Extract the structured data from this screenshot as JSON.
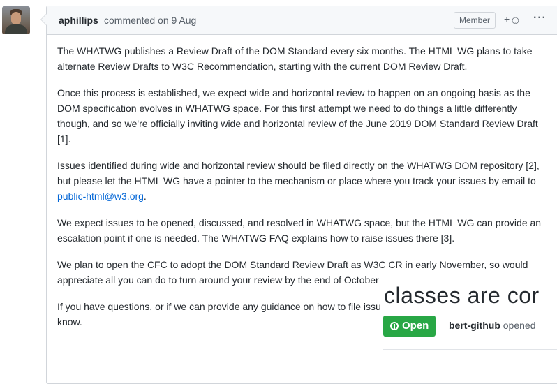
{
  "comment": {
    "author": "aphillips",
    "action": "commented on 9 Aug",
    "role_badge": "Member",
    "reaction_plus": "+",
    "reaction_icon": "☺",
    "more_icon": "···",
    "paragraphs": [
      {
        "text": "The WHATWG publishes a Review Draft of the DOM Standard every six months. The HTML WG plans to take alternate Review Drafts to W3C Recommendation, starting with the current DOM Review Draft."
      },
      {
        "text": "Once this process is established, we expect wide and horizontal review to happen on an ongoing basis as the DOM specification evolves in WHATWG space. For this first attempt we need to do things a little differently though, and so we're officially inviting wide and horizontal review of the June 2019 DOM Standard Review Draft [1]."
      },
      {
        "before": "Issues identified during wide and horizontal review should be filed directly on the WHATWG DOM repository [2], but please let the HTML WG have a pointer to the mechanism or place where you track your issues by email to ",
        "link": "public-html@w3.org",
        "after": "."
      },
      {
        "text": "We expect issues to be opened, discussed, and resolved in WHATWG space, but the HTML WG can provide an escalation point if one is needed. The WHATWG FAQ explains how to raise issues there [3]."
      },
      {
        "text": "We plan to open the CFC to adopt the DOM Standard Review Draft as W3C CR in early November, so would appreciate all you can do to turn around your review by the end of October (or sooner if possible)."
      },
      {
        "text": "If you have questions, or if we can provide any guidance on how to file issues, please don't hesitate to let us know."
      }
    ]
  },
  "overlay": {
    "title": "classes are cor",
    "status": "Open",
    "opener_user": "bert-github",
    "opener_action": "opened"
  },
  "colors": {
    "link": "#0366d6",
    "open_green": "#28a745",
    "border": "#d1d5da"
  }
}
